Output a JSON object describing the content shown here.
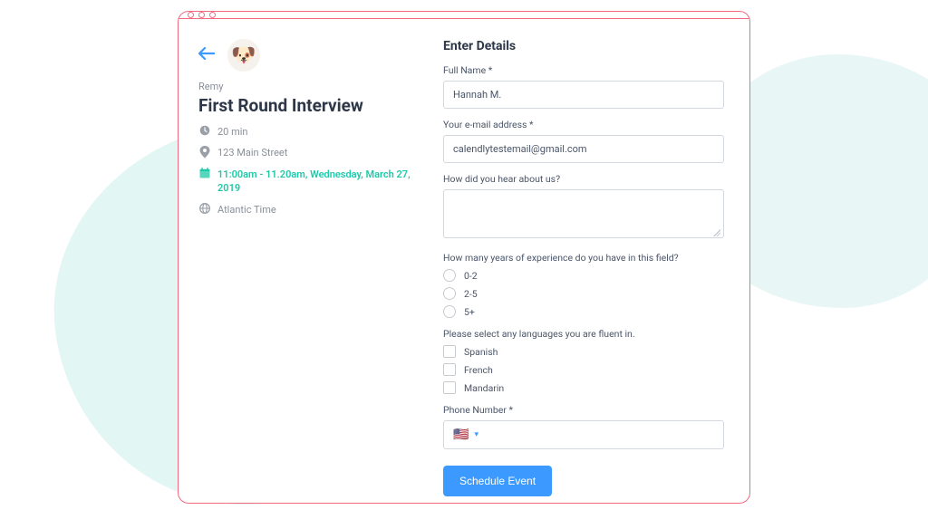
{
  "host": {
    "name": "Remy"
  },
  "event": {
    "title": "First Round Interview",
    "duration": "20 min",
    "location": "123 Main Street",
    "datetime": "11:00am - 11.20am, Wednesday, March 27, 2019",
    "timezone": "Atlantic Time"
  },
  "form": {
    "heading": "Enter Details",
    "full_name_label": "Full Name *",
    "full_name_value": "Hannah M.",
    "email_label": "Your e-mail address *",
    "email_value": "calendlytestemail@gmail.com",
    "hear_label": "How did you hear about us?",
    "hear_value": "",
    "experience_label": "How many years of experience do you have in this field?",
    "experience_options": [
      "0-2",
      "2-5",
      "5+"
    ],
    "languages_label": "Please select any languages you are fluent in.",
    "language_options": [
      "Spanish",
      "French",
      "Mandarin"
    ],
    "phone_label": "Phone Number *",
    "phone_flag": "🇺🇸",
    "submit_label": "Schedule Event"
  }
}
